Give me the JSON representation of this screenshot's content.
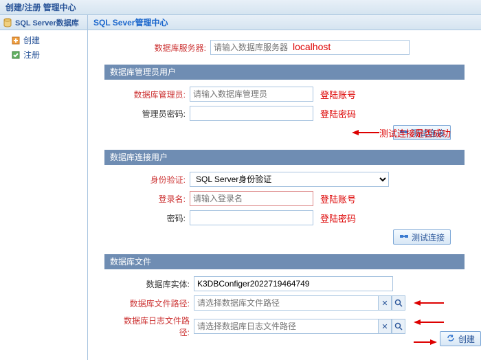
{
  "topbar": {
    "title": "创建/注册 管理中心"
  },
  "sidebar": {
    "header": "SQL Server数据库",
    "items": [
      {
        "label": "创建"
      },
      {
        "label": "注册"
      }
    ]
  },
  "content": {
    "header": "SQL Sever管理中心",
    "server": {
      "label": "数据库服务器:",
      "placeholder": "请输入数据库服务器",
      "hint": "localhost"
    },
    "admin_section": {
      "title": "数据库管理员用户",
      "admin_label": "数据库管理员:",
      "admin_placeholder": "请输入数据库管理员",
      "admin_hint": "登陆账号",
      "pwd_label": "管理员密码:",
      "pwd_hint": "登陆密码",
      "test_btn": "测试连接",
      "test_hint": "测试连接是否成功"
    },
    "conn_section": {
      "title": "数据库连接用户",
      "auth_label": "身份验证:",
      "auth_value": "SQL Server身份验证",
      "login_label": "登录名:",
      "login_placeholder": "请输入登录名",
      "login_hint": "登陆账号",
      "pwd_label": "密码:",
      "pwd_hint": "登陆密码",
      "test_btn": "测试连接"
    },
    "file_section": {
      "title": "数据库文件",
      "entity_label": "数据库实体:",
      "entity_value": "K3DBConfiger2022719464749",
      "file_path_label": "数据库文件路径:",
      "file_path_placeholder": "请选择数据库文件路径",
      "log_path_label": "数据库日志文件路径:",
      "log_path_placeholder": "请选择数据库日志文件路径"
    },
    "create_btn": "创建"
  }
}
